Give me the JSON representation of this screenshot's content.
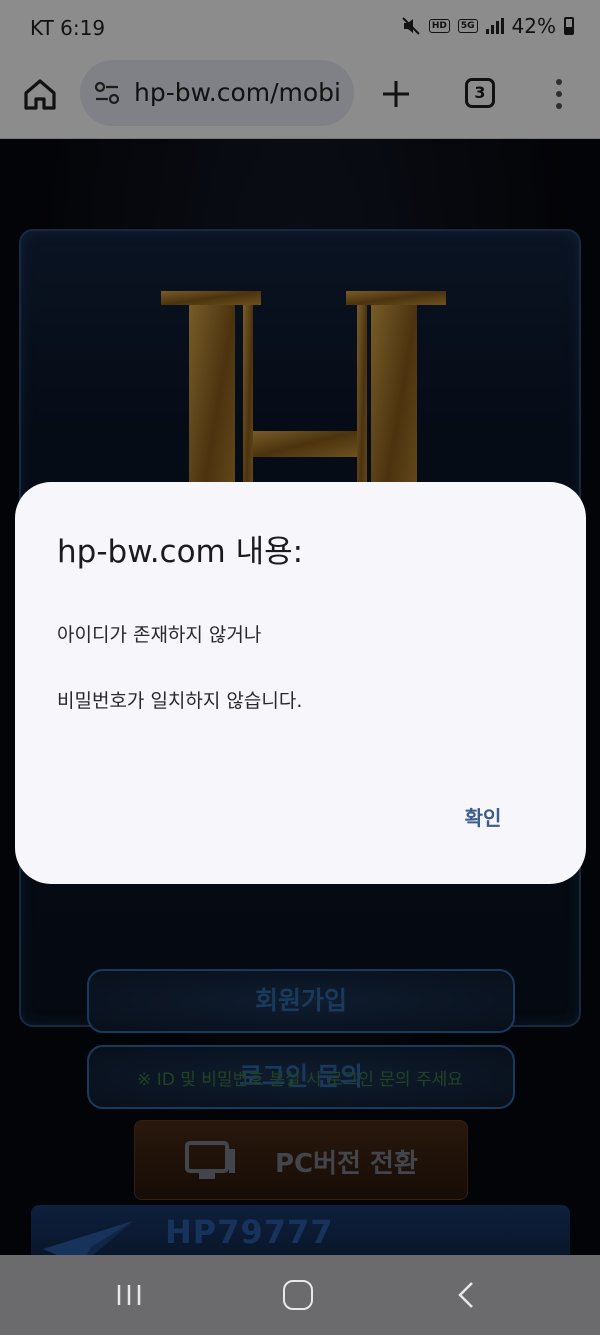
{
  "status_bar": {
    "carrier_time": "KT 6:19",
    "hd_badge": "HD",
    "network_badge": "5G",
    "battery": "42%",
    "icons": [
      "mute-icon",
      "hd-icon",
      "5g-icon",
      "signal-icon",
      "battery-icon"
    ]
  },
  "browser": {
    "url": "hp-bw.com/mobi",
    "tab_count": "3",
    "icons": [
      "home-icon",
      "site-settings-icon",
      "new-tab-icon",
      "tabs-icon",
      "more-menu-icon"
    ]
  },
  "page": {
    "signup_button": "회원가입",
    "login_inquiry_button": "로그인 문의",
    "help_note": "※ ID 및 비밀번호 분실 시 로그인 문의 주세요",
    "pc_switch_button": "PC버전 전환",
    "banner_code": "HP79777",
    "accent_gold": "#b8862e",
    "accent_blue": "#2e6aa8"
  },
  "dialog": {
    "title": "hp-bw.com 내용:",
    "message_line1": "아이디가 존재하지 않거나",
    "message_line2": "비밀번호가 일치하지 않습니다.",
    "confirm_label": "확인"
  },
  "nav_bar": {
    "icons": [
      "recent-apps-icon",
      "home-nav-icon",
      "back-icon"
    ]
  }
}
